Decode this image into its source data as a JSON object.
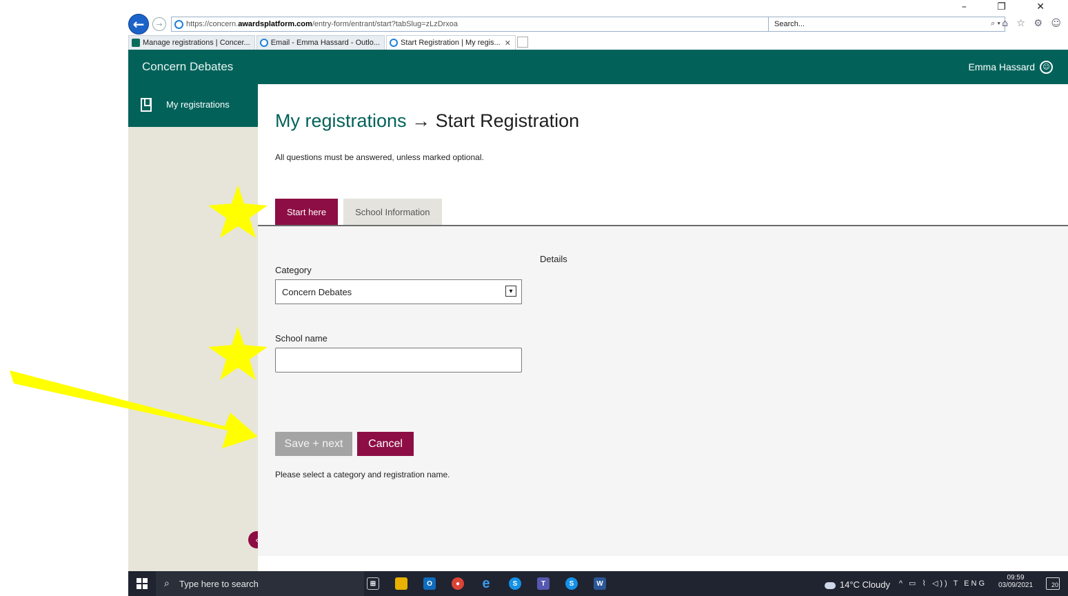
{
  "browser": {
    "url_prefix": "https://concern.",
    "url_domain": "awardsplatform.com",
    "url_path": "/entry-form/entrant/start?tabSlug=zLzDrxoa",
    "addr_tools": "▾ 🔒 ↻",
    "search_placeholder": "Search...",
    "search_icon": "⌕ ▾",
    "window_controls": "–  ❐  ✕",
    "fav_icons": "⌂ ☆ ⚙ ☺",
    "tabs": [
      {
        "label": "Manage registrations | Concer...",
        "icon": "concern-icon"
      },
      {
        "label": "Email - Emma Hassard - Outlo...",
        "icon": "ie-icon"
      },
      {
        "label": "Start Registration | My regis...",
        "icon": "ie-icon",
        "close": "✕"
      }
    ]
  },
  "header": {
    "app_title": "Concern Debates",
    "user_name": "Emma Hassard",
    "user_icon": "☺"
  },
  "sidebar": {
    "items": [
      {
        "label": "My registrations",
        "icon": "bookmark-icon"
      }
    ],
    "collapse_icon": "‹"
  },
  "main": {
    "breadcrumb": "My registrations",
    "arrow": " → ",
    "title": "Start Registration",
    "intro": "All questions must be answered, unless marked optional.",
    "tabs": [
      {
        "label": "Start here",
        "active": true
      },
      {
        "label": "School Information",
        "active": false
      }
    ],
    "details_label": "Details",
    "category_label": "Category",
    "category_value": "Concern Debates",
    "school_name_label": "School name",
    "school_name_value": "",
    "save_label": "Save + next",
    "cancel_label": "Cancel",
    "hint": "Please select a category and registration name."
  },
  "taskbar": {
    "search_placeholder": "Type here to search",
    "apps": [
      "task-view",
      "file-explorer",
      "outlook",
      "chrome",
      "internet-explorer",
      "skype",
      "teams",
      "skype-business",
      "word"
    ],
    "weather": "14°C  Cloudy",
    "tray_icons": "^ ▭ ⌇ ◁)) T ENG",
    "time": "09:59",
    "date": "03/09/2021",
    "notifications": "20"
  },
  "colors": {
    "brand_teal": "#02625a",
    "brand_maroon": "#8d0e45",
    "sidebar_bg": "#e7e5d9",
    "annotation_yellow": "#ffff00"
  }
}
